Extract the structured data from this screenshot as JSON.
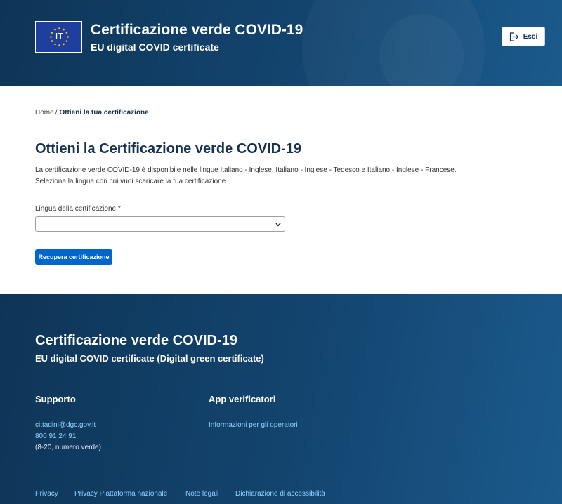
{
  "header": {
    "logo_text": "IT",
    "title": "Certificazione verde COVID-19",
    "subtitle": "EU digital COVID certificate",
    "exit_label": "Esci",
    "icon_exit": "sign-out-icon"
  },
  "breadcrumb": {
    "home": "Home",
    "separator": "/",
    "current": "Ottieni la tua certificazione"
  },
  "main": {
    "title": "Ottieni la Certificazione verde COVID-19",
    "description_line1": "La certificazione verde COVID-19 è disponibile nelle lingue Italiano - Inglese, Italiano - Inglese - Tedesco e Italiano - Inglese - Francese.",
    "description_line2": "Seleziona la lingua con cui vuoi scaricare la tua certificazione.",
    "language_label": "Lingua della certificazione:*",
    "language_value": "",
    "submit_label": "Recupera certificazione"
  },
  "footer": {
    "title": "Certificazione verde COVID-19",
    "subtitle": "EU digital COVID certificate (Digital green certificate)",
    "support": {
      "title": "Supporto",
      "email": "cittadini@dgc.gov.it",
      "phone": "800 91 24 91",
      "hours": "(8-20, numero verde)"
    },
    "verifier_apps": {
      "title": "App verificatori",
      "link": "Informazioni per gli operatori"
    },
    "bottom_links": [
      "Privacy",
      "Privacy Piattaforma nazionale",
      "Note legali",
      "Dichiarazione di accessibilità"
    ]
  },
  "colors": {
    "header_bg": "#134570",
    "accent_button": "#0066cc",
    "footer_link": "#8fd3ff",
    "eu_blue": "#1f3f9e",
    "eu_star": "#ffcc00"
  }
}
